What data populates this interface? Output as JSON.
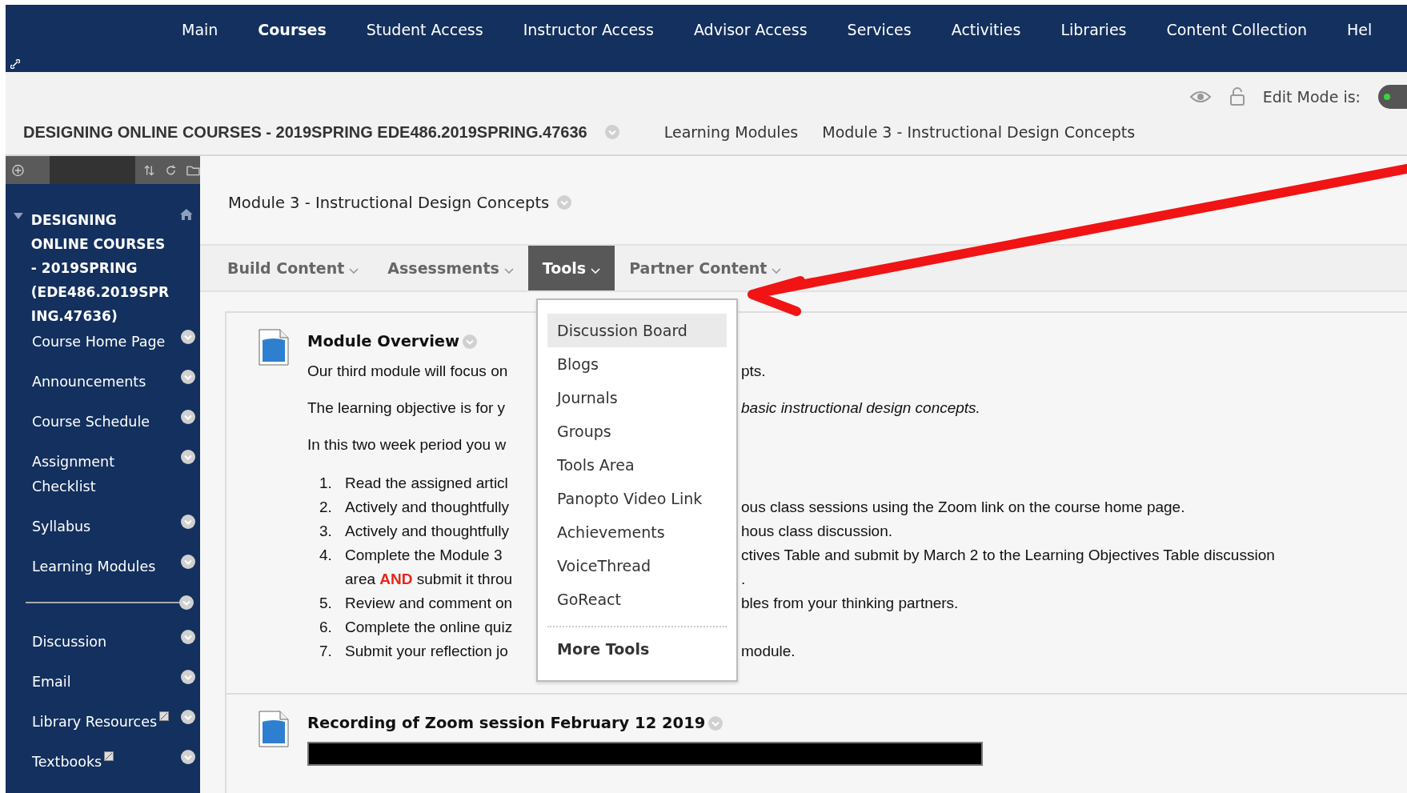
{
  "top_nav": [
    {
      "label": "Main",
      "selected": false
    },
    {
      "label": "Courses",
      "selected": true
    },
    {
      "label": "Student Access",
      "selected": false
    },
    {
      "label": "Instructor Access",
      "selected": false
    },
    {
      "label": "Advisor Access",
      "selected": false
    },
    {
      "label": "Services",
      "selected": false
    },
    {
      "label": "Activities",
      "selected": false
    },
    {
      "label": "Libraries",
      "selected": false
    },
    {
      "label": "Content Collection",
      "selected": false
    },
    {
      "label": "Hel",
      "selected": false
    }
  ],
  "edit_mode": {
    "label": "Edit Mode is:",
    "on": true
  },
  "course_title": "DESIGNING ONLINE COURSES - 2019SPRING EDE486.2019SPRING.47636",
  "breadcrumbs": [
    "Learning Modules",
    "Module 3 - Instructional Design Concepts"
  ],
  "sidebar": {
    "title": "DESIGNING ONLINE COURSES - 2019SPRING (EDE486.2019SPRING.47636)",
    "items": [
      {
        "kind": "link",
        "label": "Course Home Page",
        "external": false
      },
      {
        "kind": "link",
        "label": "Announcements",
        "external": false
      },
      {
        "kind": "link",
        "label": "Course Schedule",
        "external": false
      },
      {
        "kind": "link",
        "label": "Assignment Checklist",
        "external": false
      },
      {
        "kind": "link",
        "label": "Syllabus",
        "external": false
      },
      {
        "kind": "link",
        "label": "Learning Modules",
        "external": false
      },
      {
        "kind": "divider"
      },
      {
        "kind": "link",
        "label": "Discussion",
        "external": false
      },
      {
        "kind": "link",
        "label": "Email",
        "external": false
      },
      {
        "kind": "link",
        "label": "Library Resources",
        "external": true
      },
      {
        "kind": "link",
        "label": "Textbooks",
        "external": true
      }
    ]
  },
  "page_title": "Module 3 - Instructional Design Concepts",
  "action_bar": [
    {
      "label": "Build Content",
      "selected": false
    },
    {
      "label": "Assessments",
      "selected": false
    },
    {
      "label": "Tools",
      "selected": true
    },
    {
      "label": "Partner Content",
      "selected": false
    }
  ],
  "tools_menu": {
    "items": [
      {
        "label": "Discussion Board",
        "selected": true
      },
      {
        "label": "Blogs",
        "selected": false
      },
      {
        "label": "Journals",
        "selected": false
      },
      {
        "label": "Groups",
        "selected": false
      },
      {
        "label": "Tools Area",
        "selected": false
      },
      {
        "label": "Panopto Video Link",
        "selected": false
      },
      {
        "label": "Achievements",
        "selected": false
      },
      {
        "label": "VoiceThread",
        "selected": false
      },
      {
        "label": "GoReact",
        "selected": false
      }
    ],
    "more": "More Tools"
  },
  "content_items": [
    {
      "title": "Module Overview",
      "paragraphs": [
        {
          "left": "Our third module will focus on",
          "right": "pts."
        },
        {
          "left": "The learning objective is for y",
          "right": "*basic instructional design concepts.*"
        },
        {
          "left": "In this two week period you w"
        }
      ],
      "list": [
        {
          "number": "1.",
          "lines": [
            {
              "left": "Read the assigned articl"
            }
          ]
        },
        {
          "number": "2.",
          "lines": [
            {
              "left": "Actively and thoughtfully",
              "right": "ous class sessions using the Zoom link on the course home page."
            }
          ]
        },
        {
          "number": "3.",
          "lines": [
            {
              "left": "Actively and thoughtfully",
              "right": "hous class discussion."
            }
          ]
        },
        {
          "number": "4.",
          "lines": [
            {
              "left": "Complete the Module 3",
              "right": "ctives Table and submit by March 2 to the Learning Objectives Table discussion"
            },
            {
              "left": "area ",
              "highlight": "AND",
              "after": " submit it throu",
              "right": "."
            }
          ]
        },
        {
          "number": "5.",
          "lines": [
            {
              "left": "Review and comment on",
              "right": "bles from your thinking partners."
            }
          ]
        },
        {
          "number": "6.",
          "lines": [
            {
              "left": "Complete the online quiz"
            }
          ]
        },
        {
          "number": "7.",
          "lines": [
            {
              "left": "Submit your reflection jo",
              "right": "module."
            }
          ]
        }
      ]
    },
    {
      "title": "Recording of Zoom session February 12 2019",
      "video": true
    }
  ]
}
